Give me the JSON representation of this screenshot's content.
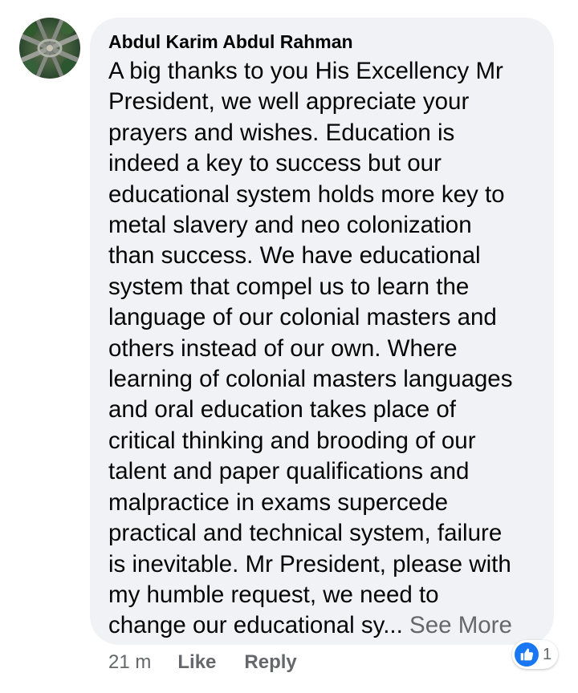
{
  "comment": {
    "author": "Abdul Karim Abdul Rahman",
    "text_lines": [
      "A big thanks to you His Excellency Mr",
      "President, we well appreciate your",
      "prayers and wishes. Education is",
      "indeed a key to success but our",
      "educational system holds more key to",
      "metal slavery and neo colonization",
      "than success. We have educational",
      "system that compel us to learn the",
      "language of our colonial masters and",
      "others instead of our own. Where",
      "learning of colonial masters languages",
      "and oral education takes place of",
      "critical thinking and brooding of our",
      "talent and paper qualifications and",
      "malpractice in exams supercede",
      "practical and technical system, failure",
      "is inevitable. Mr President, please with",
      "my humble request, we need to",
      "change our educational sy... "
    ],
    "see_more": "See More",
    "timestamp": "21 m",
    "like_label": "Like",
    "reply_label": "Reply",
    "reaction_count": "1",
    "reaction_icon": "thumbs-up-icon"
  },
  "colors": {
    "bubble": "#f0f2f5",
    "text": "#050505",
    "secondary_text": "#65676b",
    "like_blue": "#1877f2"
  }
}
